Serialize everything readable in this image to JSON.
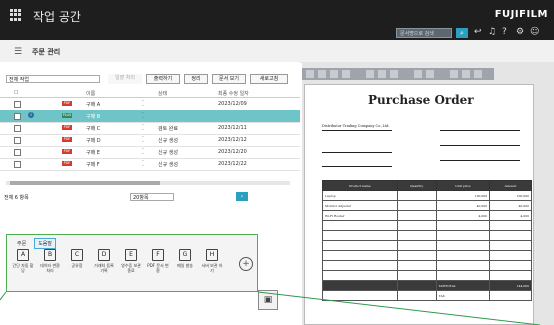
{
  "titlebar": {
    "app_title": "작업 공간",
    "brand": "FUJIFILM",
    "search_placeholder": "문서명으로 검색"
  },
  "toolbar_icons": [
    "arrow-icon",
    "notification-icon",
    "help-icon",
    "settings-icon",
    "user-icon"
  ],
  "page": {
    "title": "주문 관리"
  },
  "controls": {
    "filter_value": "전체 작업",
    "buttons": [
      "일괄 처리",
      "출력하기",
      "정리",
      "문서 보기",
      "새로고침"
    ]
  },
  "table": {
    "headers": [
      "이름",
      "상태",
      "최종 수정 일자"
    ],
    "rows": [
      {
        "name": "구매 A",
        "status": "",
        "date": "2023/12/09",
        "selected": false
      },
      {
        "name": "구매 B",
        "status": "",
        "date": "",
        "selected": true
      },
      {
        "name": "구매 C",
        "status": "검토 완료",
        "date": "2023/12/11",
        "selected": false
      },
      {
        "name": "구매 D",
        "status": "신규 생성",
        "date": "2023/12/12",
        "selected": false
      },
      {
        "name": "구매 E",
        "status": "신규 생성",
        "date": "2023/12/20",
        "selected": false
      },
      {
        "name": "구매 F",
        "status": "신규 생성",
        "date": "2023/12/22",
        "selected": false
      }
    ]
  },
  "footer": {
    "count_label": "전체 6 항목",
    "per_page": "20항목",
    "go_label": "›"
  },
  "dock": {
    "tabs": [
      "주문",
      "도움말"
    ],
    "items": [
      {
        "label": "간단 자동 할당",
        "icon": "A"
      },
      {
        "label": "데이터 변환 처리",
        "icon": "B"
      },
      {
        "label": "공유함",
        "icon": "C"
      },
      {
        "label": "거래처 등록 기록",
        "icon": "D"
      },
      {
        "label": "영수증 보관 종료",
        "icon": "E"
      },
      {
        "label": "PDF 문서 변환",
        "icon": "F"
      },
      {
        "label": "메일 발송",
        "icon": "G"
      },
      {
        "label": "서버 보관 하기",
        "icon": "H"
      }
    ],
    "add_label": "+"
  },
  "document": {
    "title": "Purchase Order",
    "company": "Distributor Trading Company Co.,Ltd.",
    "totals": {
      "subtotal_label": "SUBTOTAL",
      "tax_label": "TAX",
      "total_label": "TOTAL"
    },
    "columns": [
      "Product name",
      "Quantity",
      "Unit price",
      "Amount"
    ],
    "rows": [
      {
        "name": "Laptop",
        "qty": "",
        "price": "100,000",
        "amount": "100,000"
      },
      {
        "name": "Monitor Adjuster",
        "qty": "",
        "price": "40,000",
        "amount": "40,000"
      },
      {
        "name": "Wi-Fi Router",
        "qty": "",
        "price": "4,000",
        "amount": "4,000"
      }
    ],
    "subtotal": "144,000"
  }
}
